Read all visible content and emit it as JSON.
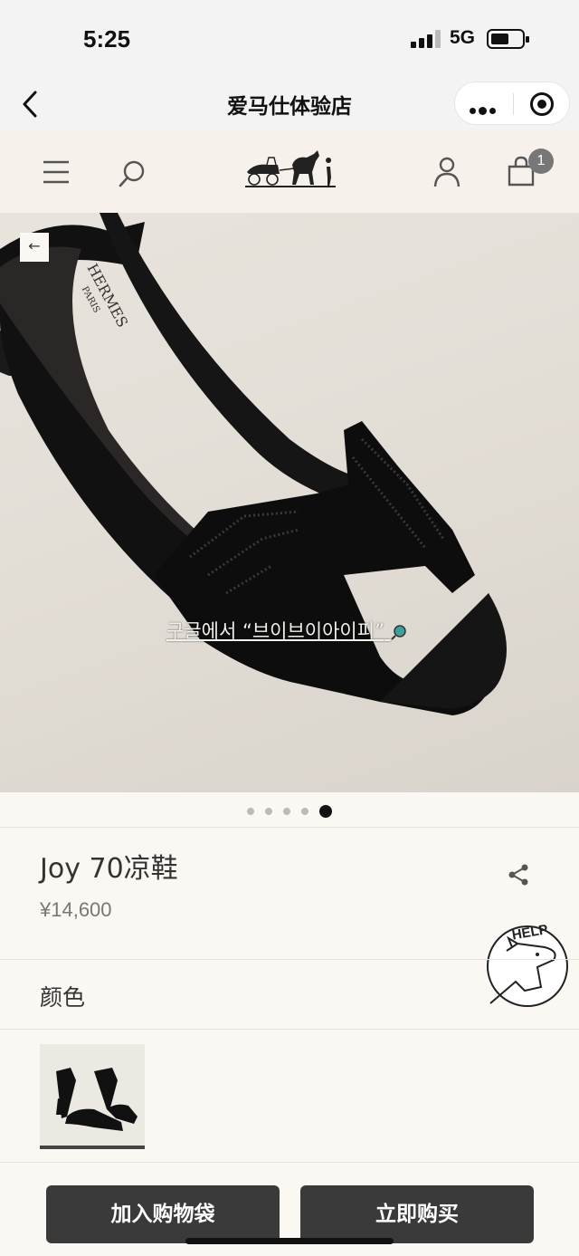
{
  "status_bar": {
    "time": "5:25",
    "network": "5G",
    "battery_level": 0.6
  },
  "wechat": {
    "title": "爱马仕体验店",
    "more_icon": "more-dots-icon",
    "close_icon": "target-close-icon"
  },
  "header": {
    "menu_icon": "hamburger-menu-icon",
    "search_icon": "search-icon",
    "logo": "hermes-carriage-logo",
    "account_icon": "user-icon",
    "cart_icon": "shopping-bag-icon",
    "cart_count": "1"
  },
  "gallery": {
    "back_arrow": "←",
    "translate_text": "구글에서 “브이브이아이피”",
    "slide_count": 5,
    "active_slide": 5
  },
  "product": {
    "name": "Joy 70凉鞋",
    "price": "¥14,600",
    "share_icon": "share-icon"
  },
  "help_badge": {
    "text": "HELP"
  },
  "color_section": {
    "label": "颜色"
  },
  "actions": {
    "add_to_bag": "加入购物袋",
    "buy_now": "立即购买"
  }
}
